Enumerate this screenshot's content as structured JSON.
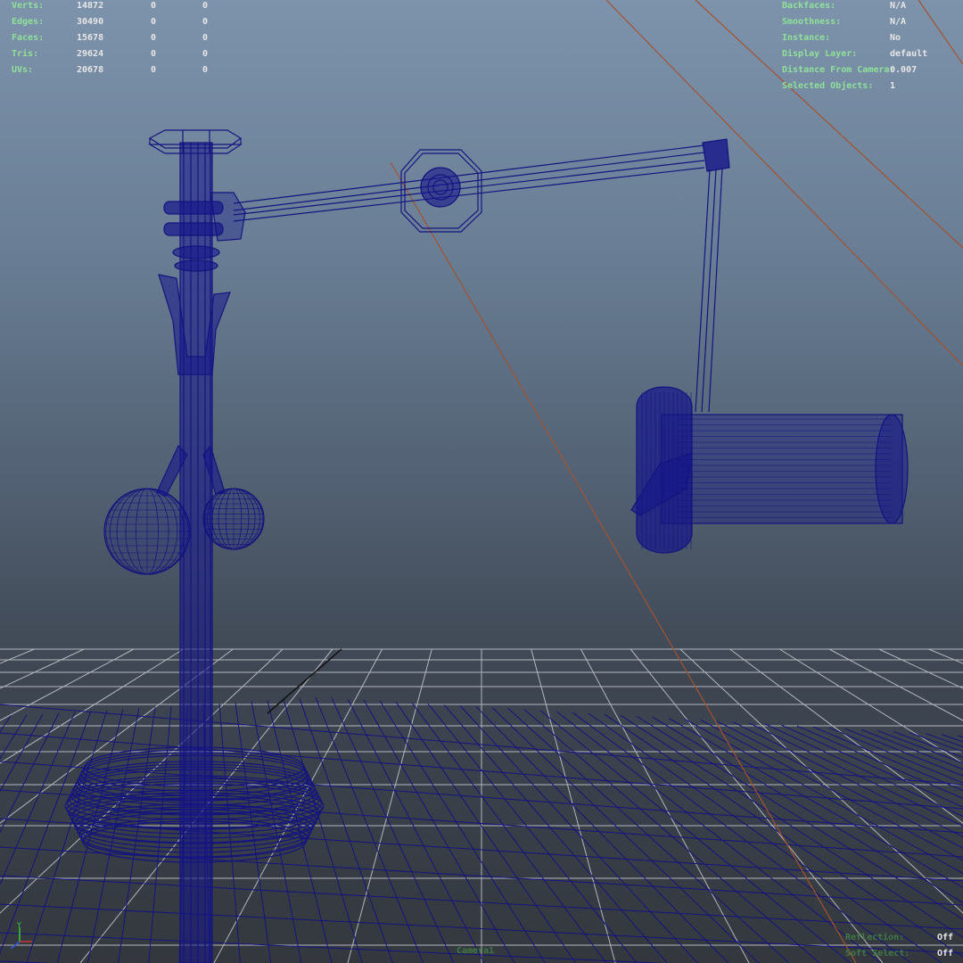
{
  "stats": {
    "rows": [
      {
        "label": "Verts:",
        "value": "14872",
        "v2": "0",
        "v3": "0"
      },
      {
        "label": "Edges:",
        "value": "30490",
        "v2": "0",
        "v3": "0"
      },
      {
        "label": "Faces:",
        "value": "15678",
        "v2": "0",
        "v3": "0"
      },
      {
        "label": "Tris:",
        "value": "29624",
        "v2": "0",
        "v3": "0"
      },
      {
        "label": "UVs:",
        "value": "20678",
        "v2": "0",
        "v3": "0"
      }
    ]
  },
  "info": {
    "rows": [
      {
        "label": "Backfaces:",
        "value": "N/A"
      },
      {
        "label": "Smoothness:",
        "value": "N/A"
      },
      {
        "label": "Instance:",
        "value": "No"
      },
      {
        "label": "Display Layer:",
        "value": "default"
      },
      {
        "label": "Distance From Camera:",
        "value": "0.007"
      },
      {
        "label": "Selected Objects:",
        "value": "1"
      }
    ]
  },
  "bottom_right": {
    "rows": [
      {
        "label": "Reflection:",
        "value": "Off"
      },
      {
        "label": "Soft Select:",
        "value": "Off"
      }
    ]
  },
  "camera_label": "Camera1",
  "axis": {
    "y_label": "Y",
    "x_label": "X"
  },
  "colors": {
    "wire": "#14147e",
    "grid": "#c9ccd2",
    "pivot_line": "#a2532f",
    "hud_label": "#8fe19a",
    "hud_value": "#e6e6e6"
  }
}
